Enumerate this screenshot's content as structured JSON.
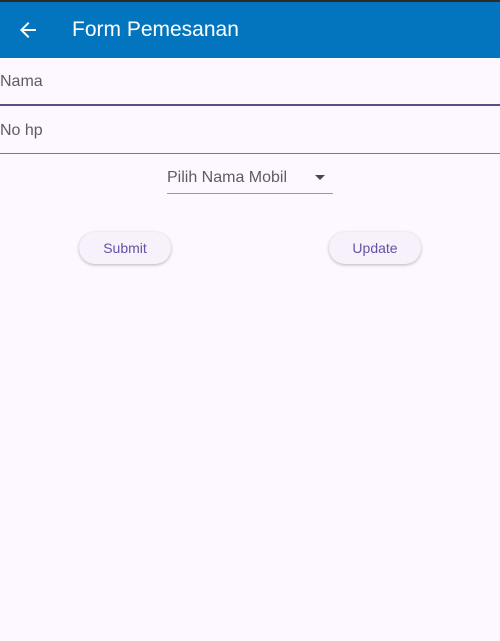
{
  "app_bar": {
    "title": "Form Pemesanan",
    "back_icon": "arrow-left-icon",
    "background_color": "#0375be"
  },
  "form": {
    "nama_field": {
      "placeholder": "Nama",
      "value": ""
    },
    "nohp_field": {
      "placeholder": "No hp",
      "value": ""
    },
    "mobil_dropdown": {
      "selected_label": "Pilih Nama Mobil",
      "icon": "dropdown-arrow-icon"
    }
  },
  "actions": {
    "submit_label": "Submit",
    "update_label": "Update",
    "accent_color": "#6750a4"
  }
}
